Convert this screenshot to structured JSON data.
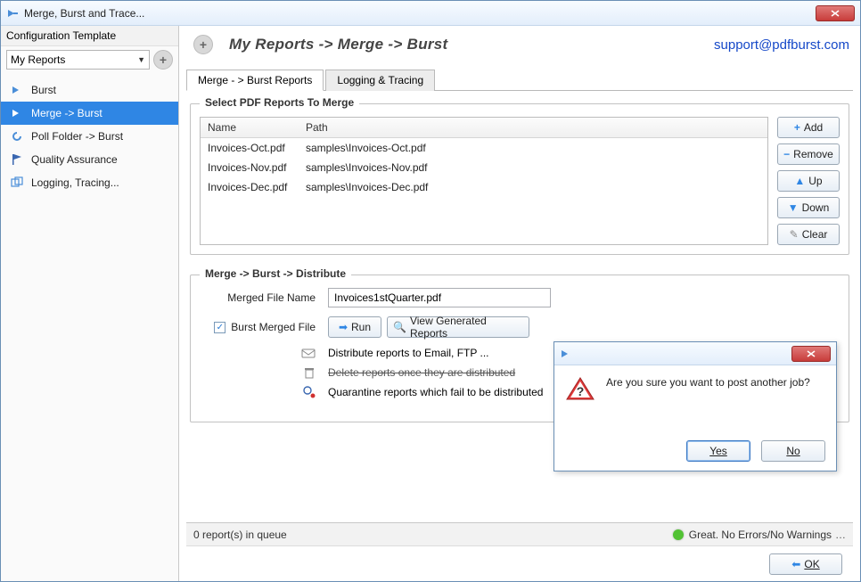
{
  "window": {
    "title": "Merge, Burst and Trace..."
  },
  "sidebar": {
    "header": "Configuration Template",
    "template_selected": "My Reports",
    "items": [
      {
        "label": "Burst"
      },
      {
        "label": "Merge -> Burst"
      },
      {
        "label": "Poll Folder -> Burst"
      },
      {
        "label": "Quality Assurance"
      },
      {
        "label": "Logging, Tracing..."
      }
    ]
  },
  "header": {
    "breadcrumb": "My Reports -> Merge -> Burst",
    "support_link": "support@pdfburst.com"
  },
  "tabs": [
    {
      "label": "Merge - > Burst Reports"
    },
    {
      "label": "Logging & Tracing"
    }
  ],
  "group_merge": {
    "title": "Select PDF Reports To Merge",
    "columns": {
      "name": "Name",
      "path": "Path"
    },
    "rows": [
      {
        "name": "Invoices-Oct.pdf",
        "path": "samples\\Invoices-Oct.pdf"
      },
      {
        "name": "Invoices-Nov.pdf",
        "path": "samples\\Invoices-Nov.pdf"
      },
      {
        "name": "Invoices-Dec.pdf",
        "path": "samples\\Invoices-Dec.pdf"
      }
    ],
    "buttons": {
      "add": "Add",
      "remove": "Remove",
      "up": "Up",
      "down": "Down",
      "clear": "Clear"
    }
  },
  "group_dist": {
    "title": "Merge -> Burst -> Distribute",
    "merged_label": "Merged File Name",
    "merged_value": "Invoices1stQuarter.pdf",
    "burst_checkbox_label": "Burst Merged File",
    "run_label": "Run",
    "view_label": "View Generated Reports",
    "line_distribute": "Distribute reports to Email, FTP ...",
    "line_delete": "Delete reports once they are distributed",
    "line_quarantine": "Quarantine reports which fail to be distributed"
  },
  "status": {
    "queue": "0 report(s) in queue",
    "message": "Great. No Errors/No Warnings"
  },
  "footer": {
    "ok": "OK"
  },
  "dialog": {
    "message": "Are you sure you want to post another job?",
    "yes": "Yes",
    "no": "No"
  }
}
